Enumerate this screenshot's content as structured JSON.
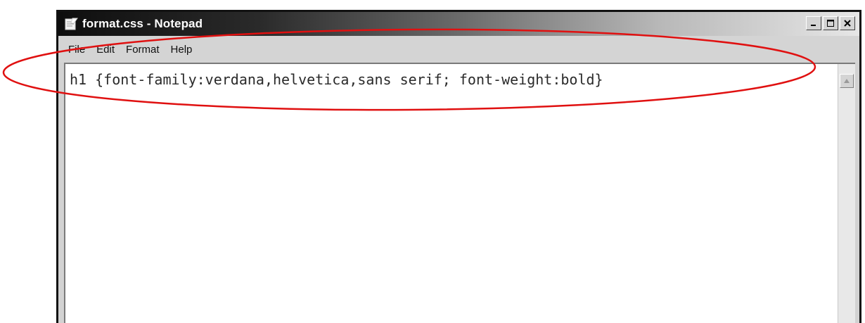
{
  "window": {
    "title": "format.css - Notepad",
    "controls": {
      "minimize": "minimize-icon",
      "maximize": "maximize-icon",
      "close": "close-icon"
    }
  },
  "menu": {
    "items": [
      {
        "label": "File"
      },
      {
        "label": "Edit"
      },
      {
        "label": "Format"
      },
      {
        "label": "Help"
      }
    ]
  },
  "editor": {
    "content": "h1 {font-family:verdana,helvetica,sans serif; font-weight:bold}"
  },
  "annotation": {
    "shape": "ellipse",
    "color": "#e01010"
  },
  "colors": {
    "titlebar_start": "#0e0e0e",
    "titlebar_end": "#e6e6e6",
    "chrome": "#d4d4d4"
  }
}
